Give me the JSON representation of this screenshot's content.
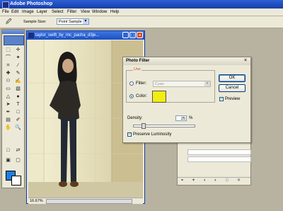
{
  "app": {
    "title": "Adobe Photoshop"
  },
  "menu": [
    "File",
    "Edit",
    "Image",
    "Layer",
    "Select",
    "Filter",
    "View",
    "Window",
    "Help"
  ],
  "options_bar": {
    "sample_size_label": "Sample Size:",
    "sample_size_value": "Point Sample"
  },
  "document": {
    "title": "taylor_swift_by_mc_pacha_d3je...",
    "zoom": "16.67%"
  },
  "dialog": {
    "title": "Photo Filter",
    "use_label": "Use",
    "filter_label": "Filter:",
    "filter_value": "Cyan",
    "color_label": "Color:",
    "color_value": "#f3ec12",
    "density_label": "Density:",
    "density_value": "25",
    "density_unit": "%",
    "preserve_label": "Preserve Luminosity",
    "preserve_checked": true,
    "preview_label": "Preview",
    "preview_checked": true,
    "ok_label": "OK",
    "cancel_label": "Cancel",
    "selected_option": "color"
  },
  "toolbox": {
    "foreground_color": "#1e7fe0",
    "background_color": "#ffffff"
  },
  "colors": {
    "title_bar": "#1b4fc0",
    "dialog_bg": "#ece9d8",
    "close_red": "#d8471f"
  }
}
